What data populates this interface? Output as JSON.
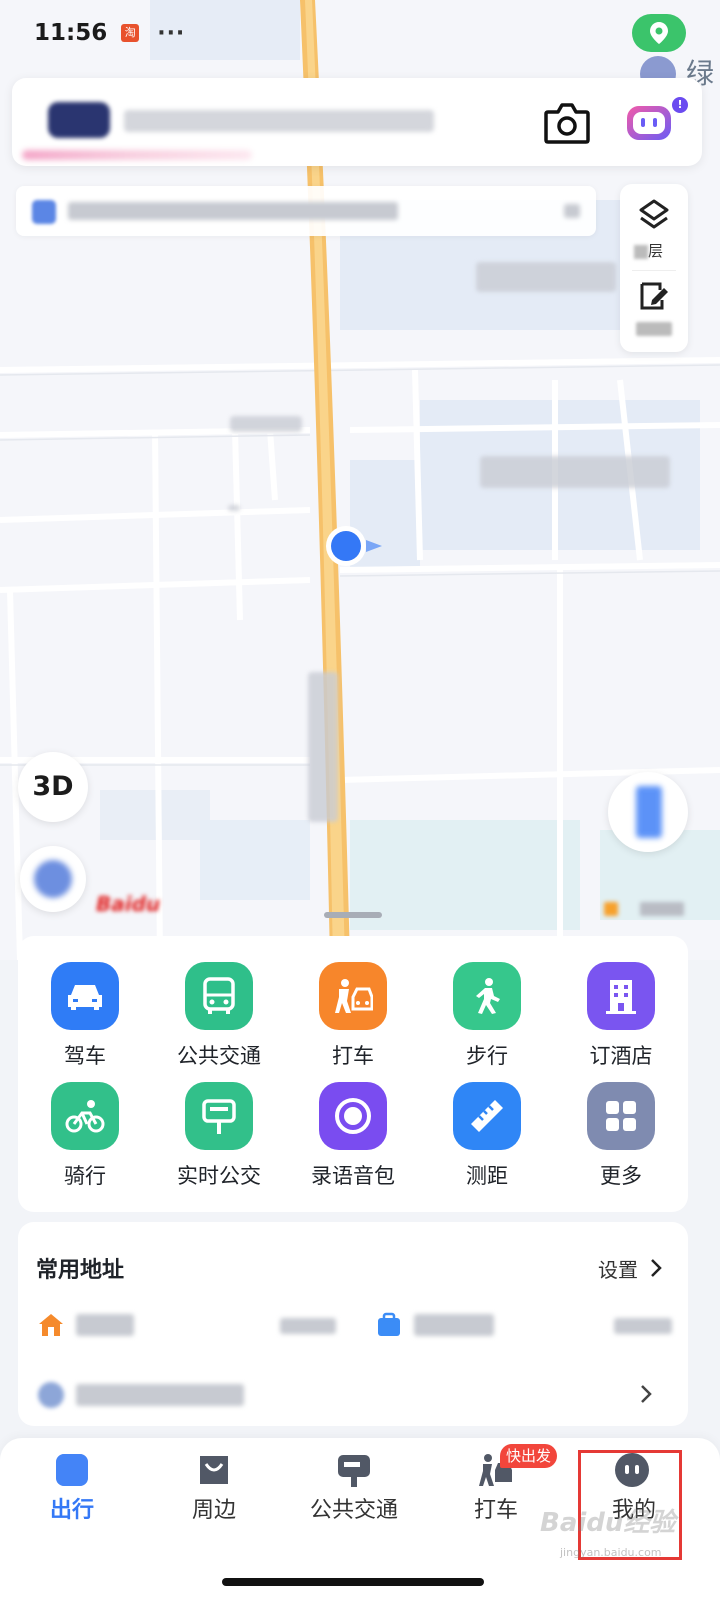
{
  "status_bar": {
    "time": "11:56",
    "app_icon_text": "淘",
    "more_dots": "···"
  },
  "map": {
    "btn_3d": "3D",
    "baidu_logo": "Baidu",
    "side_tools": [
      {
        "label": "层",
        "icon": "layers-icon"
      },
      {
        "label": "",
        "icon": "edit-icon"
      }
    ],
    "corner_label": "绿"
  },
  "quick_tools": [
    {
      "label": "驾车",
      "icon": "car-icon",
      "color": "#2f7cf6"
    },
    {
      "label": "公共交通",
      "icon": "bus-icon",
      "color": "#2fbf8a"
    },
    {
      "label": "打车",
      "icon": "taxi-icon",
      "color": "#f7862b"
    },
    {
      "label": "步行",
      "icon": "walk-icon",
      "color": "#36c78c"
    },
    {
      "label": "订酒店",
      "icon": "hotel-icon",
      "color": "#7a55f0"
    },
    {
      "label": "骑行",
      "icon": "bike-icon",
      "color": "#32c08a"
    },
    {
      "label": "实时公交",
      "icon": "bus-stop-icon",
      "color": "#32c08a"
    },
    {
      "label": "录语音包",
      "icon": "record-icon",
      "color": "#7a4cf0"
    },
    {
      "label": "测距",
      "icon": "ruler-icon",
      "color": "#2f86f6"
    },
    {
      "label": "更多",
      "icon": "grid-icon",
      "color": "#7f8bb0"
    }
  ],
  "addresses": {
    "title": "常用地址",
    "settings_label": "设置"
  },
  "bottom_nav": {
    "items": [
      {
        "label": "出行",
        "icon": "travel-icon",
        "active": true
      },
      {
        "label": "周边",
        "icon": "nearby-icon",
        "active": false
      },
      {
        "label": "公共交通",
        "icon": "transit-icon",
        "active": false
      },
      {
        "label": "打车",
        "icon": "taxi-nav-icon",
        "active": false
      },
      {
        "label": "我的",
        "icon": "profile-icon",
        "active": false
      }
    ],
    "taxi_badge": "快出发"
  },
  "watermark": {
    "text": "Baidu经验",
    "sub": "jingyan.baidu.com"
  },
  "colors": {
    "accent": "#3478f6",
    "highlight": "#e53935",
    "badge": "#f2463c"
  }
}
